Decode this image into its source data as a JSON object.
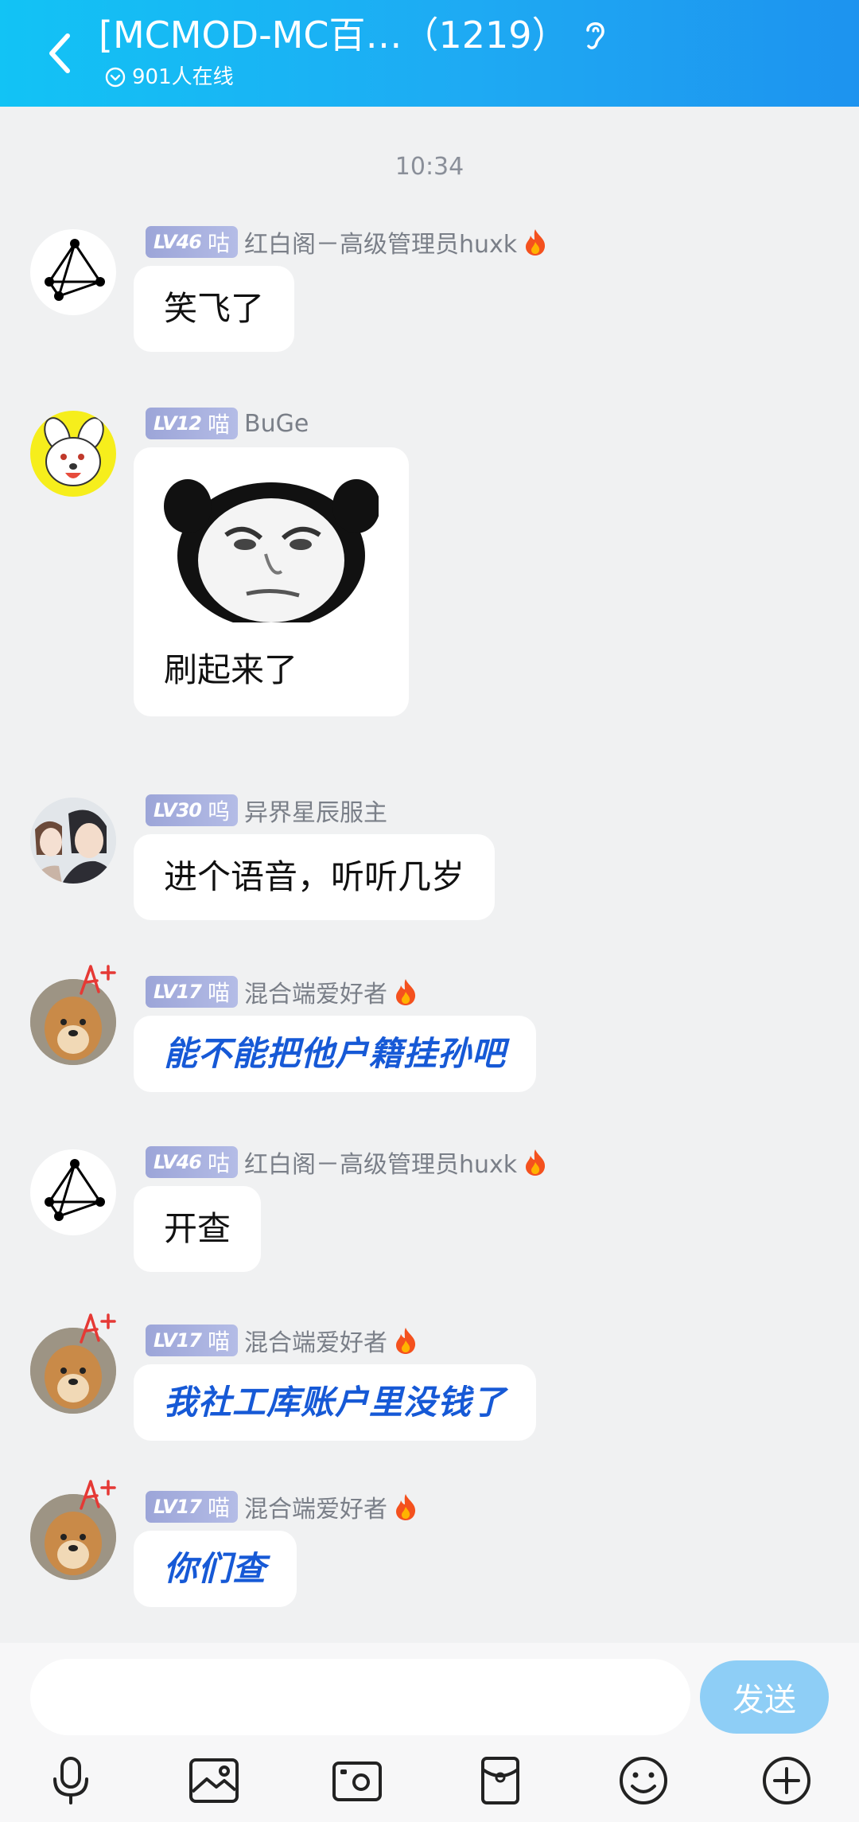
{
  "header": {
    "title": "[MCMOD-MC百…（1219）",
    "online": "901人在线",
    "bg_color": "#1eaaf3"
  },
  "chat": {
    "timestamp": "10:34",
    "messages": [
      {
        "level": "LV46",
        "title": "咕",
        "nick": "红白阁－高级管理员huxk",
        "fire": true,
        "text": "笑飞了",
        "fancy": false,
        "avatar": "network-avatar"
      },
      {
        "level": "LV12",
        "title": "喵",
        "nick": "BuGe",
        "fire": false,
        "text": "刷起来了",
        "fancy": false,
        "avatar": "dog-cartoon-avatar",
        "sticker": "panda-meme-sticker"
      },
      {
        "level": "LV30",
        "title": "呜",
        "nick": "异界星辰服主",
        "fire": false,
        "text": "进个语音，听听几岁",
        "fancy": false,
        "avatar": "anime-couple-avatar"
      },
      {
        "level": "LV17",
        "title": "喵",
        "nick": "混合端爱好者",
        "fire": true,
        "text": "能不能把他户籍挂孙吧",
        "fancy": true,
        "avatar": "doge-avatar"
      },
      {
        "level": "LV46",
        "title": "咕",
        "nick": "红白阁－高级管理员huxk",
        "fire": true,
        "text": "开查",
        "fancy": false,
        "avatar": "network-avatar"
      },
      {
        "level": "LV17",
        "title": "喵",
        "nick": "混合端爱好者",
        "fire": true,
        "text": "我社工库账户里没钱了",
        "fancy": true,
        "avatar": "doge-avatar"
      },
      {
        "level": "LV17",
        "title": "喵",
        "nick": "混合端爱好者",
        "fire": true,
        "text": "你们查",
        "fancy": true,
        "avatar": "doge-avatar"
      }
    ]
  },
  "input": {
    "placeholder": "",
    "send_label": "发送"
  },
  "toolbar": {
    "icons": [
      "microphone-icon",
      "image-icon",
      "camera-icon",
      "red-packet-icon",
      "emoji-icon",
      "plus-icon"
    ]
  },
  "colors": {
    "accent": "#1eaaf3",
    "fancy_text": "#1659d6",
    "send_button": "#8ecef6",
    "badge": "#a9b1e0"
  }
}
